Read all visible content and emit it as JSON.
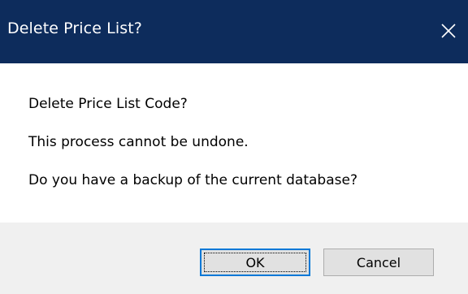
{
  "window": {
    "title": "Delete Price List?",
    "close_icon": "close-icon"
  },
  "message": {
    "line1": "Delete Price List Code?",
    "line2": "This process cannot be undone.",
    "line3": "Do you have a backup of the current database?"
  },
  "buttons": {
    "ok_label": "OK",
    "cancel_label": "Cancel"
  },
  "colors": {
    "titlebar": "#0d2c5c",
    "footer": "#f0f0f0",
    "default_button_border": "#0078d7"
  }
}
